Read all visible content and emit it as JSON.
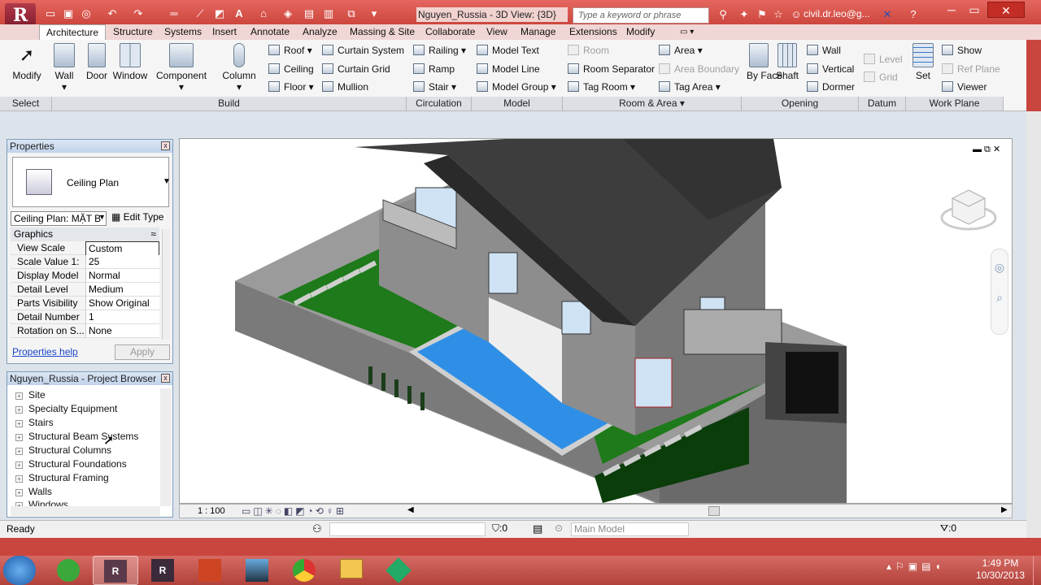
{
  "window": {
    "title": "Nguyen_Russia - 3D View: {3D}",
    "search_placeholder": "Type a keyword or phrase",
    "user": "civil.dr.leo@g...",
    "app_logo": "R"
  },
  "tabs": [
    "Architecture",
    "Structure",
    "Systems",
    "Insert",
    "Annotate",
    "Analyze",
    "Massing & Site",
    "Collaborate",
    "View",
    "Manage",
    "Extensions",
    "Modify"
  ],
  "active_tab": "Architecture",
  "ribbon": {
    "select": {
      "modify": "Modify",
      "group": "Select"
    },
    "build": {
      "wall": "Wall",
      "door": "Door",
      "window": "Window",
      "component": "Component",
      "column": "Column",
      "roof": "Roof",
      "ceiling": "Ceiling",
      "floor": "Floor",
      "curtain_system": "Curtain System",
      "curtain_grid": "Curtain Grid",
      "mullion": "Mullion",
      "group": "Build"
    },
    "circulation": {
      "railing": "Railing",
      "ramp": "Ramp",
      "stair": "Stair",
      "group": "Circulation"
    },
    "model": {
      "model_text": "Model Text",
      "model_line": "Model Line",
      "model_group": "Model Group",
      "group": "Model"
    },
    "room_area": {
      "room": "Room",
      "room_separator": "Room Separator",
      "tag_room": "Tag Room",
      "area": "Area",
      "area_boundary": "Area Boundary",
      "tag_area": "Tag Area",
      "group": "Room & Area"
    },
    "opening": {
      "by_face": "By Face",
      "shaft": "Shaft",
      "wall": "Wall",
      "vertical": "Vertical",
      "dormer": "Dormer",
      "group": "Opening"
    },
    "datum": {
      "level": "Level",
      "grid": "Grid",
      "group": "Datum"
    },
    "work_plane": {
      "set": "Set",
      "show": "Show",
      "ref_plane": "Ref Plane",
      "viewer": "Viewer",
      "group": "Work Plane"
    }
  },
  "properties": {
    "title": "Properties",
    "type_name": "Ceiling Plan",
    "instance_selector": "Ceiling Plan: MẶT B",
    "edit_type": "Edit Type",
    "section": "Graphics",
    "rows": [
      {
        "k": "View Scale",
        "v": "Custom"
      },
      {
        "k": "Scale Value   1:",
        "v": "25"
      },
      {
        "k": "Display Model",
        "v": "Normal"
      },
      {
        "k": "Detail Level",
        "v": "Medium"
      },
      {
        "k": "Parts Visibility",
        "v": "Show Original"
      },
      {
        "k": "Detail Number",
        "v": "1"
      },
      {
        "k": "Rotation on S...",
        "v": "None"
      }
    ],
    "help_link": "Properties help",
    "apply": "Apply"
  },
  "browser": {
    "title": "Nguyen_Russia - Project Browser",
    "items": [
      "Site",
      "Specialty Equipment",
      "Stairs",
      "Structural Beam Systems",
      "Structural Columns",
      "Structural Foundations",
      "Structural Framing",
      "Walls",
      "Windows"
    ]
  },
  "viewbar": {
    "scale": "1 : 100"
  },
  "status": {
    "text": "Ready",
    "selection_count": ":0",
    "workset": "Main Model",
    "filter_count": ":0"
  },
  "taskbar": {
    "time": "1:49 PM",
    "date": "10/30/2013"
  }
}
